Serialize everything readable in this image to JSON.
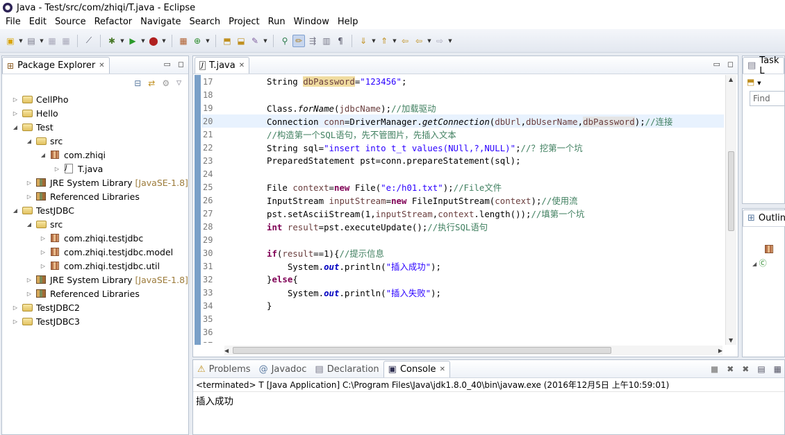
{
  "window": {
    "title": "Java - Test/src/com/zhiqi/T.java - Eclipse"
  },
  "menu": [
    "File",
    "Edit",
    "Source",
    "Refactor",
    "Navigate",
    "Search",
    "Project",
    "Run",
    "Window",
    "Help"
  ],
  "package_explorer": {
    "tab_label": "Package Explorer",
    "tree": [
      {
        "label": "CellPho",
        "level": 0,
        "twisty": "▷",
        "icon": "project"
      },
      {
        "label": "Hello",
        "level": 0,
        "twisty": "▷",
        "icon": "project"
      },
      {
        "label": "Test",
        "level": 0,
        "twisty": "◢",
        "icon": "project"
      },
      {
        "label": "src",
        "level": 1,
        "twisty": "◢",
        "icon": "src"
      },
      {
        "label": "com.zhiqi",
        "level": 2,
        "twisty": "◢",
        "icon": "package"
      },
      {
        "label": "T.java",
        "level": 3,
        "twisty": "▷",
        "icon": "java",
        "selected": true
      },
      {
        "label": "JRE System Library",
        "suffix": "[JavaSE-1.8]",
        "level": 1,
        "twisty": "▷",
        "icon": "library"
      },
      {
        "label": "Referenced Libraries",
        "level": 1,
        "twisty": "▷",
        "icon": "library"
      },
      {
        "label": "TestJDBC",
        "level": 0,
        "twisty": "◢",
        "icon": "project"
      },
      {
        "label": "src",
        "level": 1,
        "twisty": "◢",
        "icon": "src"
      },
      {
        "label": "com.zhiqi.testjdbc",
        "level": 2,
        "twisty": "▷",
        "icon": "package"
      },
      {
        "label": "com.zhiqi.testjdbc.model",
        "level": 2,
        "twisty": "▷",
        "icon": "package"
      },
      {
        "label": "com.zhiqi.testjdbc.util",
        "level": 2,
        "twisty": "▷",
        "icon": "package"
      },
      {
        "label": "JRE System Library",
        "suffix": "[JavaSE-1.8]",
        "level": 1,
        "twisty": "▷",
        "icon": "library"
      },
      {
        "label": "Referenced Libraries",
        "level": 1,
        "twisty": "▷",
        "icon": "library"
      },
      {
        "label": "TestJDBC2",
        "level": 0,
        "twisty": "▷",
        "icon": "project"
      },
      {
        "label": "TestJDBC3",
        "level": 0,
        "twisty": "▷",
        "icon": "project"
      }
    ]
  },
  "editor": {
    "tab_label": "T.java",
    "current_line": 20,
    "lines": [
      {
        "n": "17",
        "tokens": [
          [
            "plain",
            "String "
          ],
          [
            "var-hl",
            "dbPassword"
          ],
          [
            "plain",
            "="
          ],
          [
            "str",
            "\"123456\""
          ],
          [
            "plain",
            ";"
          ]
        ]
      },
      {
        "n": "18",
        "tokens": []
      },
      {
        "n": "19",
        "tokens": [
          [
            "plain",
            "Class."
          ],
          [
            "ital",
            "forName"
          ],
          [
            "plain",
            "("
          ],
          [
            "var",
            "jdbcName"
          ],
          [
            "plain",
            ");"
          ],
          [
            "cmt",
            "//加载驱动"
          ]
        ]
      },
      {
        "n": "20",
        "tokens": [
          [
            "plain",
            "Connection "
          ],
          [
            "var",
            "conn"
          ],
          [
            "plain",
            "=DriverManager."
          ],
          [
            "ital",
            "getConnection"
          ],
          [
            "plain",
            "("
          ],
          [
            "var",
            "dbUrl"
          ],
          [
            "plain",
            ","
          ],
          [
            "var",
            "dbUserName"
          ],
          [
            "plain",
            ","
          ],
          [
            "var-hl2",
            "dbPassword"
          ],
          [
            "plain",
            ");"
          ],
          [
            "cmt",
            "//连接"
          ]
        ]
      },
      {
        "n": "21",
        "tokens": [
          [
            "cmt",
            "//构造第一个SQL语句，先不管图片，先插入文本"
          ]
        ]
      },
      {
        "n": "22",
        "tokens": [
          [
            "plain",
            "String sql="
          ],
          [
            "str",
            "\"insert into t_t values(NUll,?,NULL)\""
          ],
          [
            "plain",
            ";"
          ],
          [
            "cmt",
            "//？挖第一个坑"
          ]
        ]
      },
      {
        "n": "23",
        "tokens": [
          [
            "plain",
            "PreparedStatement pst=conn.prepareStatement(sql);"
          ]
        ]
      },
      {
        "n": "24",
        "tokens": []
      },
      {
        "n": "25",
        "tokens": [
          [
            "plain",
            "File "
          ],
          [
            "var",
            "context"
          ],
          [
            "plain",
            "="
          ],
          [
            "kw",
            "new"
          ],
          [
            "plain",
            " File("
          ],
          [
            "str",
            "\"e:/h01.txt\""
          ],
          [
            "plain",
            ");"
          ],
          [
            "cmt",
            "//File文件"
          ]
        ]
      },
      {
        "n": "26",
        "tokens": [
          [
            "plain",
            "InputStream "
          ],
          [
            "var",
            "inputStream"
          ],
          [
            "plain",
            "="
          ],
          [
            "kw",
            "new"
          ],
          [
            "plain",
            " FileInputStream("
          ],
          [
            "var",
            "context"
          ],
          [
            "plain",
            ");"
          ],
          [
            "cmt",
            "//使用流"
          ]
        ]
      },
      {
        "n": "27",
        "tokens": [
          [
            "plain",
            "pst.setAsciiStream(1,"
          ],
          [
            "var",
            "inputStream"
          ],
          [
            "plain",
            ","
          ],
          [
            "var",
            "context"
          ],
          [
            "plain",
            ".length());"
          ],
          [
            "cmt",
            "//填第一个坑"
          ]
        ]
      },
      {
        "n": "28",
        "tokens": [
          [
            "kw",
            "int"
          ],
          [
            "plain",
            " "
          ],
          [
            "var",
            "result"
          ],
          [
            "plain",
            "=pst.executeUpdate();"
          ],
          [
            "cmt",
            "//执行SQL语句"
          ]
        ]
      },
      {
        "n": "29",
        "tokens": []
      },
      {
        "n": "30",
        "tokens": [
          [
            "kw",
            "if"
          ],
          [
            "plain",
            "("
          ],
          [
            "var",
            "result"
          ],
          [
            "plain",
            "==1){"
          ],
          [
            "cmt",
            "//提示信息"
          ]
        ]
      },
      {
        "n": "31",
        "tokens": [
          [
            "plain",
            "    System."
          ],
          [
            "fld",
            "out"
          ],
          [
            "plain",
            ".println("
          ],
          [
            "str",
            "\"插入成功\""
          ],
          [
            "plain",
            ");"
          ]
        ]
      },
      {
        "n": "32",
        "tokens": [
          [
            "plain",
            "}"
          ],
          [
            "kw",
            "else"
          ],
          [
            "plain",
            "{"
          ]
        ]
      },
      {
        "n": "33",
        "tokens": [
          [
            "plain",
            "    System."
          ],
          [
            "fld",
            "out"
          ],
          [
            "plain",
            ".println("
          ],
          [
            "str",
            "\"插入失败\""
          ],
          [
            "plain",
            ");"
          ]
        ]
      },
      {
        "n": "34",
        "tokens": [
          [
            "plain",
            "}"
          ]
        ]
      },
      {
        "n": "35",
        "tokens": []
      },
      {
        "n": "36",
        "tokens": []
      },
      {
        "n": "37",
        "tokens": []
      }
    ]
  },
  "bottom_tabs": [
    {
      "label": "Problems",
      "icon": "problems-icon"
    },
    {
      "label": "Javadoc",
      "icon": "javadoc-icon"
    },
    {
      "label": "Declaration",
      "icon": "declaration-icon"
    },
    {
      "label": "Console",
      "icon": "console-icon",
      "selected": true
    }
  ],
  "console": {
    "status": "<terminated> T [Java Application] C:\\Program Files\\Java\\jdk1.8.0_40\\bin\\javaw.exe (2016年12月5日 上午10:59:01)",
    "output": "插入成功"
  },
  "task_list": {
    "tab_label": "Task L",
    "find_placeholder": "Find"
  },
  "outline": {
    "tab_label": "Outlin"
  }
}
